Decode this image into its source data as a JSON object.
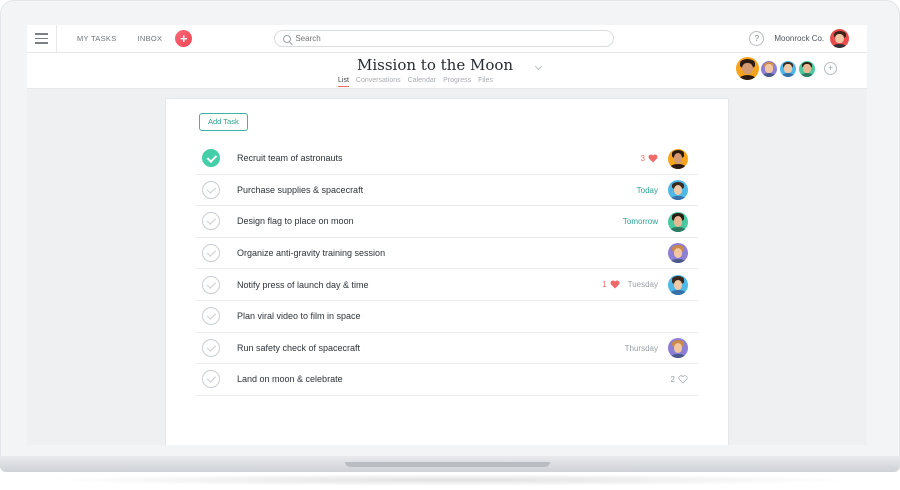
{
  "topbar": {
    "menu_icon": "hamburger-menu-icon",
    "my_tasks": "MY TASKS",
    "inbox": "INBOX",
    "add_icon": "plus-icon",
    "search_placeholder": "Search",
    "help": "?",
    "org_name": "Moonrock Co."
  },
  "project": {
    "title": "Mission to the Moon",
    "tabs": [
      {
        "label": "List",
        "active": true
      },
      {
        "label": "Conversations",
        "active": false
      },
      {
        "label": "Calendar",
        "active": false
      },
      {
        "label": "Progress",
        "active": false
      },
      {
        "label": "Files",
        "active": false
      }
    ],
    "add_member": "+"
  },
  "list": {
    "add_task_label": "Add Task",
    "tasks": [
      {
        "name": "Recruit team of astronauts",
        "completed": true,
        "likes": "3",
        "liked": true,
        "due": ""
      },
      {
        "name": "Purchase supplies & spacecraft",
        "completed": false,
        "likes": "",
        "due": "Today"
      },
      {
        "name": "Design flag to place on moon",
        "completed": false,
        "likes": "",
        "due": "Tomorrow"
      },
      {
        "name": "Organize anti-gravity training session",
        "completed": false,
        "likes": "",
        "due": ""
      },
      {
        "name": "Notify press of launch day & time",
        "completed": false,
        "likes": "1",
        "liked": true,
        "due": "Tuesday"
      },
      {
        "name": "Plan viral video to film in space",
        "completed": false,
        "likes": "",
        "due": ""
      },
      {
        "name": "Run safety check of spacecraft",
        "completed": false,
        "likes": "",
        "due": "Thursday"
      },
      {
        "name": "Land on moon & celebrate",
        "completed": false,
        "likes": "2",
        "liked": false,
        "due": ""
      }
    ]
  },
  "colors": {
    "accent_teal": "#45cfa9",
    "accent_coral": "#f06a6a",
    "plus_button": "#f4424f"
  }
}
